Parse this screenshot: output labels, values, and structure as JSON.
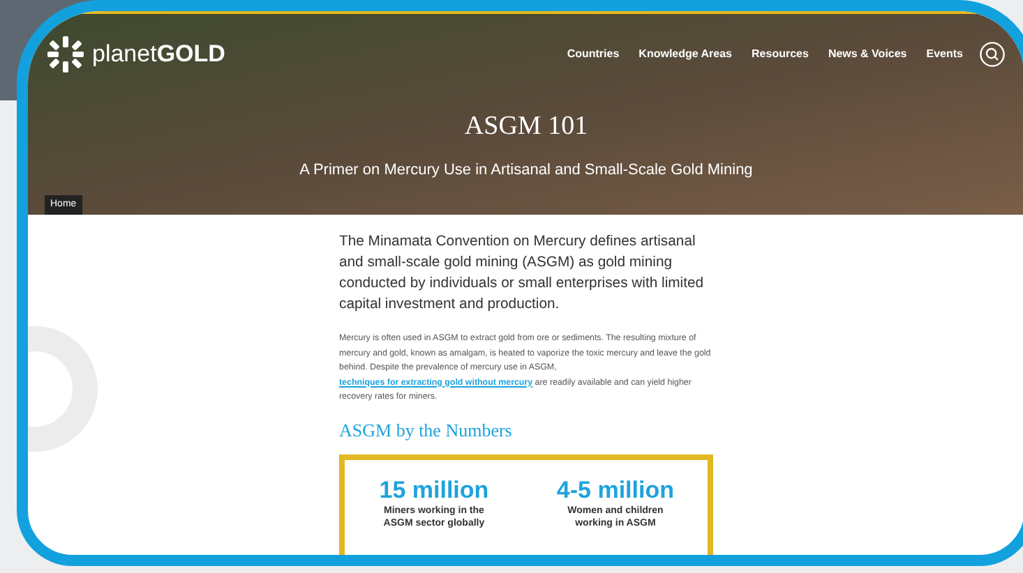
{
  "logo": {
    "text": "planet**GOLD**"
  },
  "nav": [
    {
      "label": "Countries"
    },
    {
      "label": "Knowledge Areas"
    },
    {
      "label": "Resources"
    },
    {
      "label": "News & Voices"
    },
    {
      "label": "Events"
    }
  ],
  "hero": {
    "title": "ASGM 101",
    "subtitle": "A Primer on Mercury Use in Artisanal and Small-Scale Gold Mining",
    "breadcrumb": "Home"
  },
  "intro": "The Minamata Convention on Mercury defines artisanal and small-scale gold mining (ASGM) as gold mining conducted by individuals or small enterprises with limited capital investment and production.",
  "body": {
    "before": "Mercury is often used in ASGM to extract gold from ore or sediments. The resulting mixture of mercury and gold, known as amalgam, is heated to vaporize the toxic mercury and leave the gold behind. Despite the prevalence of mercury use in ASGM,",
    "link": "techniques for extracting gold without mercury",
    "after": "are readily available and can yield higher recovery rates for miners."
  },
  "heading": "ASGM by the Numbers",
  "stats": [
    {
      "value": "15 million",
      "label": "Miners working in the ASGM sector globally"
    },
    {
      "value": "4-5 million",
      "label": "Women and children working in ASGM"
    }
  ]
}
